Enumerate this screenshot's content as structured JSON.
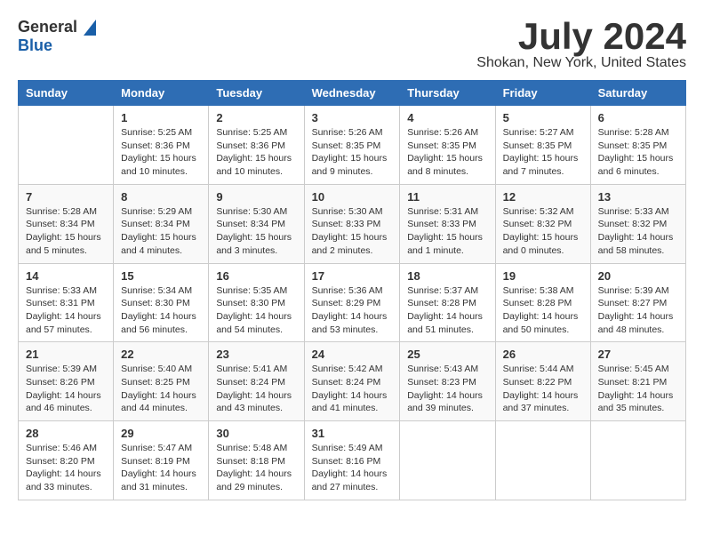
{
  "logo": {
    "line1": "General",
    "line2": "Blue"
  },
  "title": "July 2024",
  "location": "Shokan, New York, United States",
  "weekdays": [
    "Sunday",
    "Monday",
    "Tuesday",
    "Wednesday",
    "Thursday",
    "Friday",
    "Saturday"
  ],
  "weeks": [
    [
      {
        "day": "",
        "info": ""
      },
      {
        "day": "1",
        "info": "Sunrise: 5:25 AM\nSunset: 8:36 PM\nDaylight: 15 hours\nand 10 minutes."
      },
      {
        "day": "2",
        "info": "Sunrise: 5:25 AM\nSunset: 8:36 PM\nDaylight: 15 hours\nand 10 minutes."
      },
      {
        "day": "3",
        "info": "Sunrise: 5:26 AM\nSunset: 8:35 PM\nDaylight: 15 hours\nand 9 minutes."
      },
      {
        "day": "4",
        "info": "Sunrise: 5:26 AM\nSunset: 8:35 PM\nDaylight: 15 hours\nand 8 minutes."
      },
      {
        "day": "5",
        "info": "Sunrise: 5:27 AM\nSunset: 8:35 PM\nDaylight: 15 hours\nand 7 minutes."
      },
      {
        "day": "6",
        "info": "Sunrise: 5:28 AM\nSunset: 8:35 PM\nDaylight: 15 hours\nand 6 minutes."
      }
    ],
    [
      {
        "day": "7",
        "info": "Sunrise: 5:28 AM\nSunset: 8:34 PM\nDaylight: 15 hours\nand 5 minutes."
      },
      {
        "day": "8",
        "info": "Sunrise: 5:29 AM\nSunset: 8:34 PM\nDaylight: 15 hours\nand 4 minutes."
      },
      {
        "day": "9",
        "info": "Sunrise: 5:30 AM\nSunset: 8:34 PM\nDaylight: 15 hours\nand 3 minutes."
      },
      {
        "day": "10",
        "info": "Sunrise: 5:30 AM\nSunset: 8:33 PM\nDaylight: 15 hours\nand 2 minutes."
      },
      {
        "day": "11",
        "info": "Sunrise: 5:31 AM\nSunset: 8:33 PM\nDaylight: 15 hours\nand 1 minute."
      },
      {
        "day": "12",
        "info": "Sunrise: 5:32 AM\nSunset: 8:32 PM\nDaylight: 15 hours\nand 0 minutes."
      },
      {
        "day": "13",
        "info": "Sunrise: 5:33 AM\nSunset: 8:32 PM\nDaylight: 14 hours\nand 58 minutes."
      }
    ],
    [
      {
        "day": "14",
        "info": "Sunrise: 5:33 AM\nSunset: 8:31 PM\nDaylight: 14 hours\nand 57 minutes."
      },
      {
        "day": "15",
        "info": "Sunrise: 5:34 AM\nSunset: 8:30 PM\nDaylight: 14 hours\nand 56 minutes."
      },
      {
        "day": "16",
        "info": "Sunrise: 5:35 AM\nSunset: 8:30 PM\nDaylight: 14 hours\nand 54 minutes."
      },
      {
        "day": "17",
        "info": "Sunrise: 5:36 AM\nSunset: 8:29 PM\nDaylight: 14 hours\nand 53 minutes."
      },
      {
        "day": "18",
        "info": "Sunrise: 5:37 AM\nSunset: 8:28 PM\nDaylight: 14 hours\nand 51 minutes."
      },
      {
        "day": "19",
        "info": "Sunrise: 5:38 AM\nSunset: 8:28 PM\nDaylight: 14 hours\nand 50 minutes."
      },
      {
        "day": "20",
        "info": "Sunrise: 5:39 AM\nSunset: 8:27 PM\nDaylight: 14 hours\nand 48 minutes."
      }
    ],
    [
      {
        "day": "21",
        "info": "Sunrise: 5:39 AM\nSunset: 8:26 PM\nDaylight: 14 hours\nand 46 minutes."
      },
      {
        "day": "22",
        "info": "Sunrise: 5:40 AM\nSunset: 8:25 PM\nDaylight: 14 hours\nand 44 minutes."
      },
      {
        "day": "23",
        "info": "Sunrise: 5:41 AM\nSunset: 8:24 PM\nDaylight: 14 hours\nand 43 minutes."
      },
      {
        "day": "24",
        "info": "Sunrise: 5:42 AM\nSunset: 8:24 PM\nDaylight: 14 hours\nand 41 minutes."
      },
      {
        "day": "25",
        "info": "Sunrise: 5:43 AM\nSunset: 8:23 PM\nDaylight: 14 hours\nand 39 minutes."
      },
      {
        "day": "26",
        "info": "Sunrise: 5:44 AM\nSunset: 8:22 PM\nDaylight: 14 hours\nand 37 minutes."
      },
      {
        "day": "27",
        "info": "Sunrise: 5:45 AM\nSunset: 8:21 PM\nDaylight: 14 hours\nand 35 minutes."
      }
    ],
    [
      {
        "day": "28",
        "info": "Sunrise: 5:46 AM\nSunset: 8:20 PM\nDaylight: 14 hours\nand 33 minutes."
      },
      {
        "day": "29",
        "info": "Sunrise: 5:47 AM\nSunset: 8:19 PM\nDaylight: 14 hours\nand 31 minutes."
      },
      {
        "day": "30",
        "info": "Sunrise: 5:48 AM\nSunset: 8:18 PM\nDaylight: 14 hours\nand 29 minutes."
      },
      {
        "day": "31",
        "info": "Sunrise: 5:49 AM\nSunset: 8:16 PM\nDaylight: 14 hours\nand 27 minutes."
      },
      {
        "day": "",
        "info": ""
      },
      {
        "day": "",
        "info": ""
      },
      {
        "day": "",
        "info": ""
      }
    ]
  ]
}
